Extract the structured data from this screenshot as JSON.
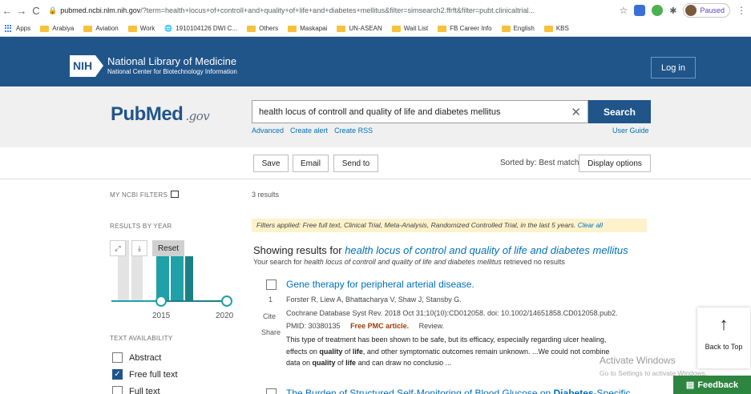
{
  "browser": {
    "back": "←",
    "forward": "→",
    "reload": "C",
    "url_host": "pubmed.ncbi.nlm.nih.gov",
    "url_rest": "/?term=health+locus+of+controll+and+quality+of+life+and+diabetes+mellitus&filter=simsearch2.ffrft&filter=pubt.clinicaltrial...",
    "star": "☆",
    "paused_label": "Paused",
    "menu": "⋮"
  },
  "bookmarks": [
    {
      "label": "Apps",
      "icon": "apps-grid-icon"
    },
    {
      "label": "Arabiya",
      "icon": "folder-icon"
    },
    {
      "label": "Aviation",
      "icon": "folder-icon"
    },
    {
      "label": "Work",
      "icon": "folder-icon"
    },
    {
      "label": "1910104126 DWI C...",
      "icon": "globe-icon"
    },
    {
      "label": "Others",
      "icon": "folder-icon"
    },
    {
      "label": "Maskapai",
      "icon": "folder-icon"
    },
    {
      "label": "UN-ASEAN",
      "icon": "folder-icon"
    },
    {
      "label": "Wait List",
      "icon": "folder-icon"
    },
    {
      "label": "FB Career Info",
      "icon": "folder-icon"
    },
    {
      "label": "English",
      "icon": "folder-icon"
    },
    {
      "label": "KBS",
      "icon": "folder-icon"
    }
  ],
  "nih": {
    "logo_text": "NIH",
    "title": "National Library of Medicine",
    "subtitle": "National Center for Biotechnology Information",
    "login": "Log in"
  },
  "search": {
    "logo_pub": "Pub",
    "logo_med": "Med",
    "logo_gov": ".gov",
    "query": "health locus of controll and quality of life and diabetes mellitus",
    "clear": "✕",
    "button": "Search",
    "links": [
      "Advanced",
      "Create alert",
      "Create RSS"
    ],
    "user_guide": "User Guide"
  },
  "actions": {
    "save": "Save",
    "email": "Email",
    "send_to": "Send to",
    "sorted_by": "Sorted by: Best match",
    "display_options": "Display options"
  },
  "sidebar": {
    "my_ncbi_filters": "MY NCBI FILTERS",
    "results_by_year": "RESULTS BY YEAR",
    "reset": "Reset",
    "expand": "⤢",
    "download": "⤓",
    "year_start": "2015",
    "year_end": "2020",
    "text_availability": "TEXT AVAILABILITY",
    "options": [
      {
        "label": "Abstract",
        "checked": false
      },
      {
        "label": "Free full text",
        "checked": true
      },
      {
        "label": "Full text",
        "checked": false
      }
    ]
  },
  "results": {
    "count": "3 results",
    "filters_applied": "Filters applied: Free full text, Clinical Trial, Meta-Analysis, Randomized Controlled Trial, in the last 5 years.",
    "clear_all": "Clear all",
    "showing_prefix": "Showing results for",
    "showing_query": "health locus of control and quality of life and diabetes mellitus",
    "your_search_prefix": "Your search for",
    "your_search_query": "health locus of controll and quality of life and diabetes mellitus",
    "your_search_suffix": "retrieved no results",
    "items": [
      {
        "number": "1",
        "title": "Gene therapy for peripheral arterial disease.",
        "authors": "Forster R, Liew A, Bhattacharya V, Shaw J, Stansby G.",
        "citation": "Cochrane Database Syst Rev. 2018 Oct 31;10(10):CD012058. doi: 10.1002/14651858.CD012058.pub2.",
        "pmid": "PMID: 30380135",
        "free_pmc": "Free PMC article.",
        "type": "Review.",
        "cite": "Cite",
        "share": "Share",
        "snippet_1": "This type of treatment has been shown to be safe, but its efficacy, especially regarding ulcer healing,",
        "snippet_2a": "effects on ",
        "snippet_2b": "quality",
        "snippet_2c": " of ",
        "snippet_2d": "life",
        "snippet_2e": ", and other symptomatic outcomes remain unknown. ...We could not combine",
        "snippet_3a": "data on ",
        "snippet_3b": "quality",
        "snippet_3c": " of ",
        "snippet_3d": "life",
        "snippet_3e": " and can draw no conclusio ..."
      },
      {
        "title_a": "The Burden of Structured Self-Monitoring of Blood Glucose on ",
        "title_b": "Diabetes",
        "title_c": "-Specific"
      }
    ]
  },
  "floating": {
    "back_to_top_arrow": "↑",
    "back_to_top": "Back to Top",
    "watermark_title": "Activate Windows",
    "watermark_sub": "Go to Settings to activate Windows.",
    "feedback": "Feedback"
  },
  "colors": {
    "nih_blue": "#20558a",
    "link_blue": "#0071bc",
    "chart_teal": "#20a0a8",
    "feedback_green": "#2e8540",
    "filter_bg": "#fdf2cc"
  }
}
